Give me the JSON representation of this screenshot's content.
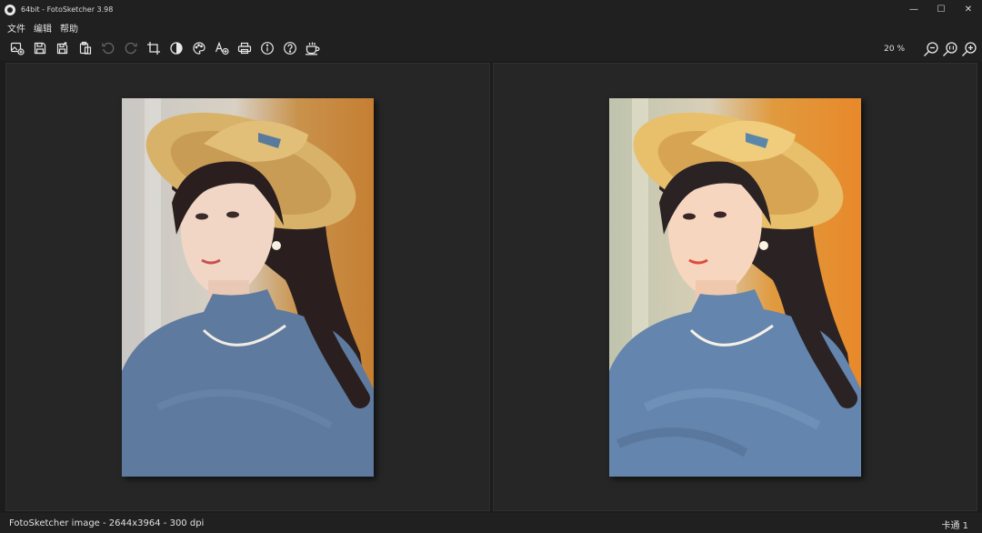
{
  "window": {
    "title": "64bit - FotoSketcher 3.98",
    "controls": {
      "minimize": "—",
      "maximize": "☐",
      "close": "✕"
    }
  },
  "menu": {
    "items": [
      "文件",
      "编辑",
      "帮助"
    ]
  },
  "toolbar": {
    "tools": [
      {
        "icon": "open-image-icon"
      },
      {
        "icon": "save-icon"
      },
      {
        "icon": "save-as-icon"
      },
      {
        "icon": "paste-icon"
      },
      {
        "icon": "undo-icon",
        "disabled": true
      },
      {
        "icon": "redo-icon",
        "disabled": true
      },
      {
        "icon": "crop-icon"
      },
      {
        "icon": "contrast-icon"
      },
      {
        "icon": "palette-icon"
      },
      {
        "icon": "text-icon"
      },
      {
        "icon": "print-icon"
      },
      {
        "icon": "info-icon"
      },
      {
        "icon": "help-icon"
      },
      {
        "icon": "coffee-cup-icon"
      }
    ],
    "zoom_level": "20 %",
    "zoom_tools": [
      "zoom-out-icon",
      "zoom-actual-icon",
      "zoom-in-icon"
    ]
  },
  "status": {
    "left": "FotoSketcher image - 2644x3964 - 300 dpi",
    "right": "卡通 1"
  },
  "colors": {
    "background": "#1c1c1c",
    "panel": "#262626",
    "chrome": "#202020"
  }
}
